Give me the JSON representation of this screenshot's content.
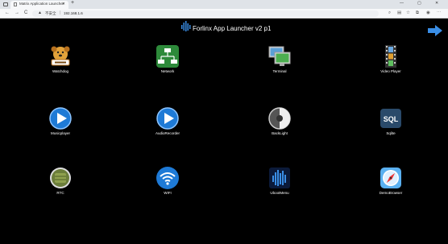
{
  "browser": {
    "tab_title": "Matrix Application Launcher",
    "tab_close": "✕",
    "new_tab": "+",
    "minimize": "—",
    "maximize": "▢",
    "close": "✕",
    "back": "←",
    "forward": "→",
    "reload": "C",
    "security_icon": "warning-triangle",
    "security_label": "不安全",
    "address": "192.168.1.6"
  },
  "page": {
    "title": "Forlinx App Launcher v2 p1",
    "next_icon": "right-arrow"
  },
  "apps": [
    {
      "label": "Watchdog",
      "icon": "watchdog-dog"
    },
    {
      "label": "Network",
      "icon": "network"
    },
    {
      "label": "Terminal",
      "icon": "terminal-monitors"
    },
    {
      "label": "Video Player",
      "icon": "film-strip"
    },
    {
      "label": "Musicplayer",
      "icon": "play-circle"
    },
    {
      "label": "AudioRecorder",
      "icon": "play-circle"
    },
    {
      "label": "BackLight",
      "icon": "backlight-dial"
    },
    {
      "label": "Sqlite",
      "icon": "sql"
    },
    {
      "label": "RTC",
      "icon": "rtc-chip"
    },
    {
      "label": "WIFI",
      "icon": "wifi"
    },
    {
      "label": "UbootMenu",
      "icon": "uboot-bars"
    },
    {
      "label": "DemoBrowser",
      "icon": "compass"
    }
  ],
  "colors": {
    "background": "#000000",
    "accent_blue": "#3a8ee6"
  }
}
